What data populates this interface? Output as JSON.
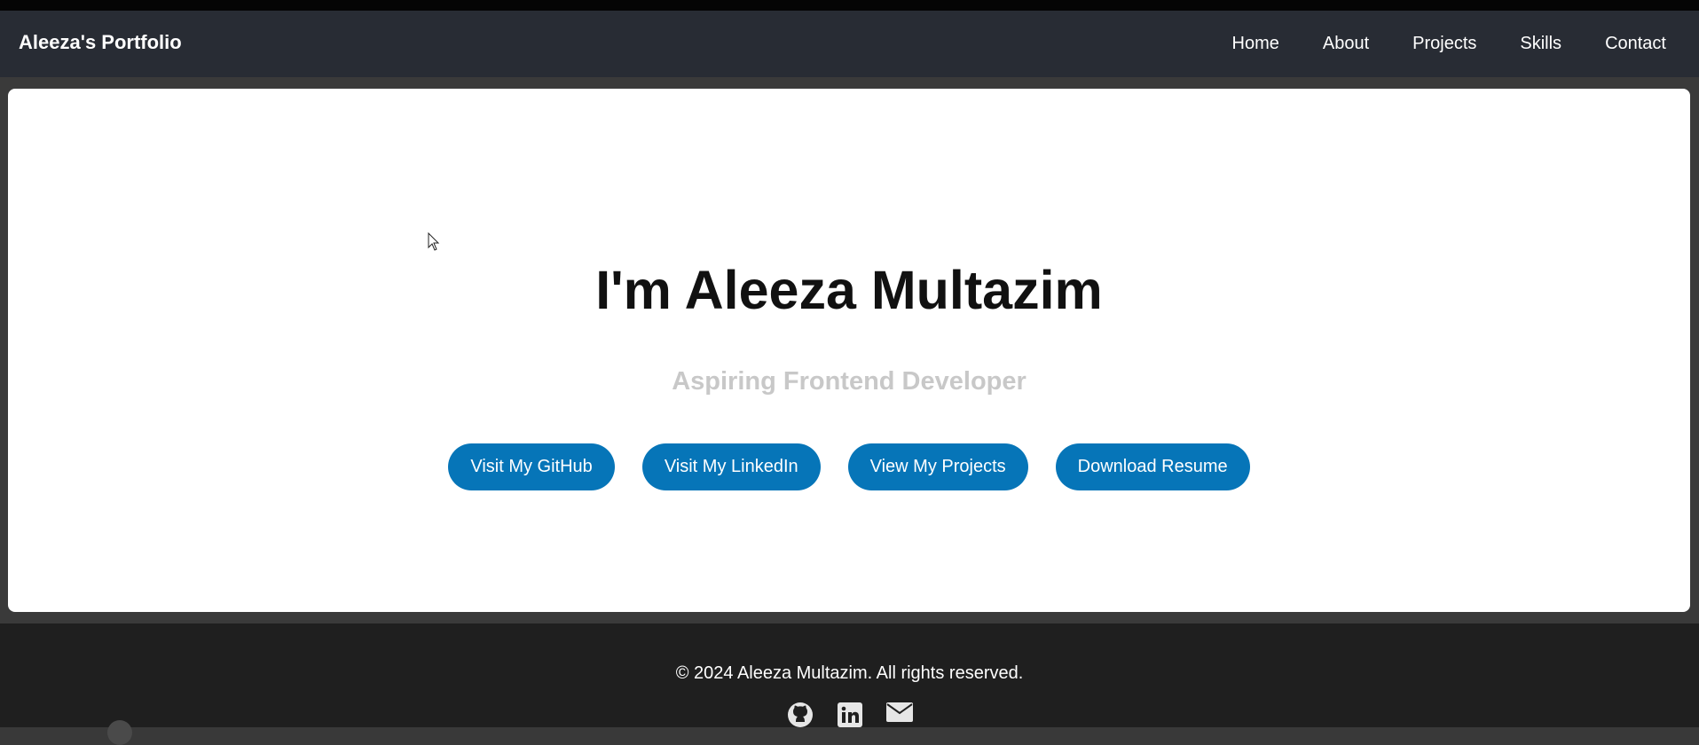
{
  "navbar": {
    "brand": "Aleeza's Portfolio",
    "links": [
      "Home",
      "About",
      "Projects",
      "Skills",
      "Contact"
    ]
  },
  "hero": {
    "title": "I'm Aleeza Multazim",
    "subtitle": "Aspiring Frontend Developer",
    "buttons": [
      "Visit My GitHub",
      "Visit My LinkedIn",
      "View My Projects",
      "Download Resume"
    ]
  },
  "footer": {
    "copyright": "© 2024 Aleeza Multazim. All rights reserved.",
    "social_icons": [
      "github-icon",
      "linkedin-icon",
      "email-icon"
    ]
  },
  "colors": {
    "navbar_bg": "#282c34",
    "button_bg": "#0675b8",
    "footer_bg": "#1f1f1f",
    "subtitle": "#c8c8c8"
  }
}
